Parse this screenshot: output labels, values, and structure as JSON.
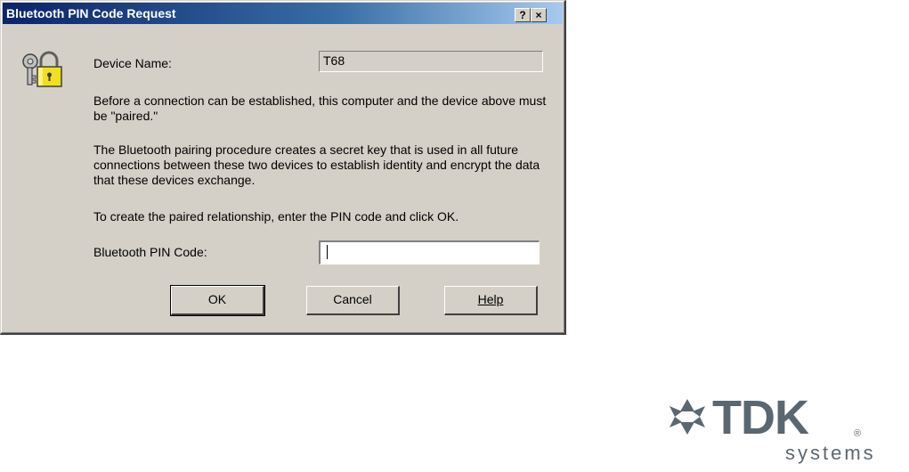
{
  "window": {
    "title": "Bluetooth PIN Code Request",
    "help_button": "?",
    "close_button": "×"
  },
  "device": {
    "label": "Device Name:",
    "value": "T68"
  },
  "messages": {
    "paired_notice": "Before a connection can be established, this computer and the device above must be \"paired.\"",
    "pairing_explanation": "The Bluetooth pairing procedure creates a secret key that is used in all future connections between these two devices to establish identity and encrypt the data that these devices exchange.",
    "instruction": "To create the paired relationship, enter the PIN code and click OK."
  },
  "pin": {
    "label": "Bluetooth PIN Code:",
    "value": "",
    "placeholder": ""
  },
  "buttons": {
    "ok": "OK",
    "cancel": "Cancel",
    "help": "Help"
  },
  "logo": {
    "brand": "TDK",
    "registered": "®",
    "subtitle": "systems"
  },
  "icons": {
    "dialog_icon": "lock-key-icon",
    "logo_icon": "tdk-star-logo-icon"
  },
  "colors": {
    "titlebar_start": "#0a246a",
    "titlebar_end": "#a6caf0",
    "dialog_face": "#d4d0c8",
    "logo_gray": "#5b6770"
  }
}
